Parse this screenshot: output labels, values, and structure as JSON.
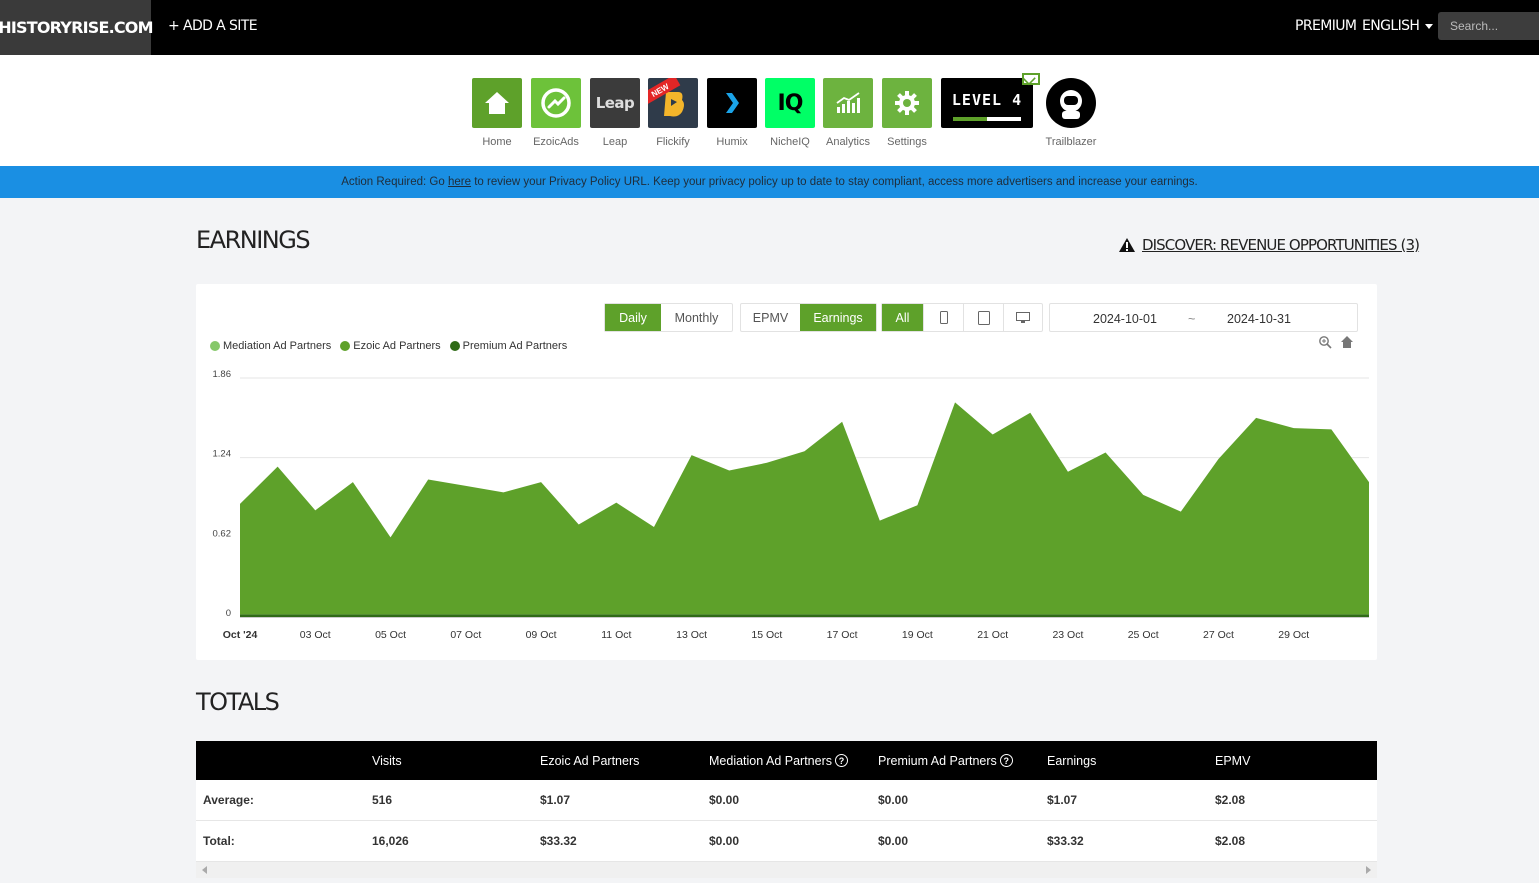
{
  "topbar": {
    "site": "HISTORYRISE.COM",
    "add_site": "+ ADD A SITE",
    "premium": "PREMIUM",
    "language": "ENGLISH",
    "search_placeholder": "Search..."
  },
  "apps": [
    {
      "label": "Home",
      "icon": "home-icon",
      "color": "#5ea12a"
    },
    {
      "label": "EzoicAds",
      "icon": "ezoicads-icon",
      "color": "#6dc23a"
    },
    {
      "label": "Leap",
      "icon": "leap-icon",
      "color": "#3b3b3b",
      "tile_text": "Leap"
    },
    {
      "label": "Flickify",
      "icon": "flickify-icon",
      "color": "#2f3b4a",
      "badge": "NEW"
    },
    {
      "label": "Humix",
      "icon": "humix-icon",
      "color": "#000000"
    },
    {
      "label": "NicheIQ",
      "icon": "nicheiq-icon",
      "color": "#00ff66",
      "tile_text": "IQ"
    },
    {
      "label": "Analytics",
      "icon": "analytics-icon",
      "color": "#6db33f"
    },
    {
      "label": "Settings",
      "icon": "gear-icon",
      "color": "#6db33f"
    }
  ],
  "level": {
    "text": "LEVEL 4",
    "progress": 0.5
  },
  "trailblazer": {
    "label": "Trailblazer"
  },
  "alert": {
    "prefix": "Action Required: Go ",
    "link": "here",
    "suffix": " to review your Privacy Policy URL. Keep your privacy policy up to date to stay compliant, access more advertisers and increase your earnings."
  },
  "earnings": {
    "title": "EARNINGS",
    "discover": "DISCOVER: REVENUE OPPORTUNITIES (3)"
  },
  "controls": {
    "period": [
      {
        "label": "Daily",
        "active": true
      },
      {
        "label": "Monthly",
        "active": false
      }
    ],
    "metric": [
      {
        "label": "EPMV",
        "active": false
      },
      {
        "label": "Earnings",
        "active": true
      }
    ],
    "device": [
      {
        "label": "All",
        "active": true
      }
    ],
    "date_from": "2024-10-01",
    "date_sep": "~",
    "date_to": "2024-10-31"
  },
  "chart_data": {
    "type": "area",
    "legend": [
      {
        "name": "Mediation Ad Partners",
        "color": "#86c86a"
      },
      {
        "name": "Ezoic Ad Partners",
        "color": "#5ea12a"
      },
      {
        "name": "Premium Ad Partners",
        "color": "#2f6b17"
      }
    ],
    "yticks": [
      "0",
      "0.62",
      "1.24",
      "1.86"
    ],
    "ylim": [
      0,
      1.86
    ],
    "xtick_labels": [
      "Oct '24",
      "03 Oct",
      "05 Oct",
      "07 Oct",
      "09 Oct",
      "11 Oct",
      "13 Oct",
      "15 Oct",
      "17 Oct",
      "19 Oct",
      "21 Oct",
      "23 Oct",
      "25 Oct",
      "27 Oct",
      "29 Oct"
    ],
    "x": [
      "2024-10-01",
      "2024-10-02",
      "2024-10-03",
      "2024-10-04",
      "2024-10-05",
      "2024-10-06",
      "2024-10-07",
      "2024-10-08",
      "2024-10-09",
      "2024-10-10",
      "2024-10-11",
      "2024-10-12",
      "2024-10-13",
      "2024-10-14",
      "2024-10-15",
      "2024-10-16",
      "2024-10-17",
      "2024-10-18",
      "2024-10-19",
      "2024-10-20",
      "2024-10-21",
      "2024-10-22",
      "2024-10-23",
      "2024-10-24",
      "2024-10-25",
      "2024-10-26",
      "2024-10-27",
      "2024-10-28",
      "2024-10-29",
      "2024-10-30",
      "2024-10-31"
    ],
    "series": [
      {
        "name": "Mediation Ad Partners",
        "values": [
          0,
          0,
          0,
          0,
          0,
          0,
          0,
          0,
          0,
          0,
          0,
          0,
          0,
          0,
          0,
          0,
          0,
          0,
          0,
          0,
          0,
          0,
          0,
          0,
          0,
          0,
          0,
          0,
          0,
          0,
          0
        ]
      },
      {
        "name": "Ezoic Ad Partners",
        "values": [
          0.86,
          1.15,
          0.81,
          1.03,
          0.6,
          1.05,
          1.0,
          0.95,
          1.03,
          0.7,
          0.87,
          0.68,
          1.24,
          1.12,
          1.18,
          1.27,
          1.5,
          0.73,
          0.85,
          1.65,
          1.4,
          1.57,
          1.11,
          1.26,
          0.93,
          0.8,
          1.21,
          1.53,
          1.45,
          1.44,
          1.03
        ]
      },
      {
        "name": "Premium Ad Partners",
        "values": [
          0.02,
          0.02,
          0.02,
          0.02,
          0.02,
          0.02,
          0.02,
          0.02,
          0.02,
          0.02,
          0.02,
          0.02,
          0.02,
          0.02,
          0.02,
          0.02,
          0.02,
          0.02,
          0.02,
          0.02,
          0.02,
          0.02,
          0.02,
          0.02,
          0.02,
          0.02,
          0.02,
          0.02,
          0.02,
          0.02,
          0.02
        ]
      }
    ]
  },
  "totals": {
    "title": "TOTALS",
    "headers": [
      "",
      "Visits",
      "Ezoic Ad Partners",
      "Mediation Ad Partners",
      "Premium Ad Partners",
      "Earnings",
      "EPMV"
    ],
    "rows": [
      [
        "Average:",
        "516",
        "$1.07",
        "$0.00",
        "$0.00",
        "$1.07",
        "$2.08"
      ],
      [
        "Total:",
        "16,026",
        "$33.32",
        "$0.00",
        "$0.00",
        "$33.32",
        "$2.08"
      ]
    ]
  }
}
